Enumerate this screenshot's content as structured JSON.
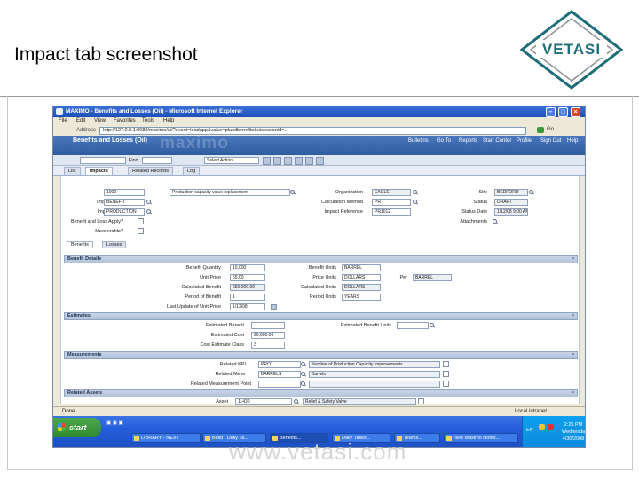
{
  "slide": {
    "title": "Impact tab screenshot",
    "logo_text": "VETASI",
    "watermark": "www.vetasi.com",
    "colors": {
      "logo_teal": "#1f6e7a",
      "logo_grey": "#8a9296"
    }
  },
  "window": {
    "title": "MAXIMO - Benefits and Losses (Oil) - Microsoft Internet Explorer",
    "menu": [
      "File",
      "Edit",
      "View",
      "Favorites",
      "Tools",
      "Help"
    ],
    "address_label": "Address",
    "address_url": "http://127.0.0.1:9080/maximo/ui/?event=loadapp&value=plusdbenefits&uisessionid=...",
    "go_label": "Go",
    "controls": [
      "minimize-icon",
      "maximize-icon",
      "close-icon"
    ]
  },
  "app": {
    "title": "Benefits and Losses (Oil)",
    "brand": "maximo",
    "header_links": [
      "Bulletins",
      "Go To",
      "Reports",
      "Start Center",
      "Profile",
      "Sign Out",
      "Help"
    ],
    "find_label": "Find",
    "select_action": "Select Action",
    "tabs": [
      "List",
      "Impacts",
      "Related Records",
      "Log"
    ],
    "active_tab": "Impacts"
  },
  "form": {
    "impact": {
      "label": "Impact",
      "value": "1002",
      "description": "Production capacity value replacement"
    },
    "impact_type": {
      "label": "Impact Type",
      "value": "BENEFIT"
    },
    "impact_area": {
      "label": "Impact Area",
      "value": "PRODUCTION"
    },
    "benefit_loss_apply": {
      "label": "Benefit and Loss Apply?"
    },
    "measurable": {
      "label": "Measurable?"
    },
    "organization": {
      "label": "Organization",
      "value": "EAGLE"
    },
    "calculation_method": {
      "label": "Calculation Method",
      "value": "PR"
    },
    "impact_reference": {
      "label": "Impact Reference",
      "value": "PR1012"
    },
    "site": {
      "label": "Site",
      "value": "BEDFORD"
    },
    "status": {
      "label": "Status",
      "value": "DRAFT"
    },
    "status_date": {
      "label": "Status Date",
      "value": "1/12/08 9:00 AM"
    },
    "attachments": {
      "label": "Attachments"
    }
  },
  "subtabs": [
    "Benefits",
    "Losses"
  ],
  "benefit_details": {
    "header": "Benefit Details",
    "benefit_quantity": {
      "label": "Benefit Quantity",
      "value": "10,000"
    },
    "unit_price": {
      "label": "Unit Price",
      "value": "65.00"
    },
    "calculated_benefit": {
      "label": "Calculated Benefit",
      "value": "650,000.00"
    },
    "period_of_benefit": {
      "label": "Period of Benefit",
      "value": "1"
    },
    "last_update": {
      "label": "Last Update of Unit Price",
      "value": "1/12/08"
    },
    "benefit_units": {
      "label": "Benefit Units",
      "value": "BARREL"
    },
    "price_units": {
      "label": "Price Units",
      "value": "DOLLARS"
    },
    "calculated_units": {
      "label": "Calculated Units",
      "value": "DOLLARS"
    },
    "period_units": {
      "label": "Period Units",
      "value": "YEARS"
    },
    "per": {
      "label": "Per",
      "value": "BARREL"
    }
  },
  "estimates": {
    "header": "Estimates",
    "estimated_benefit": {
      "label": "Estimated Benefit",
      "value": ""
    },
    "estimated_cost": {
      "label": "Estimated Cost",
      "value": "20,000.00"
    },
    "cost_estimate_class": {
      "label": "Cost Estimate Class",
      "value": "3"
    },
    "estimated_benefit_units": {
      "label": "Estimated Benefit Units",
      "value": ""
    }
  },
  "measurements": {
    "header": "Measurements",
    "related_kpi": {
      "label": "Related KPI",
      "value": "PRO1",
      "description": "Number of Production Capacity Improvements"
    },
    "related_meter": {
      "label": "Related Meter",
      "value": "BARRELS",
      "description": "Barrels"
    },
    "related_measurement_point": {
      "label": "Related Measurement Point",
      "value": "",
      "description": ""
    }
  },
  "related_assets": {
    "header": "Related Assets",
    "asset": {
      "label": "Asset",
      "value": "11430",
      "description": "Relief & Safety Valve"
    }
  },
  "ie_status": {
    "left": "Done",
    "right": "Local intranet"
  },
  "taskbar": {
    "start": "start",
    "buttons": [
      "LIBRARY - NEXT",
      "Build | Daily Ta...",
      "Benefits...",
      "Daily Tasks...",
      "Teams...",
      "New Maximo Notes..."
    ],
    "clock": "2:25 PM Wednesday 4/30/2008",
    "lang": "EN"
  }
}
